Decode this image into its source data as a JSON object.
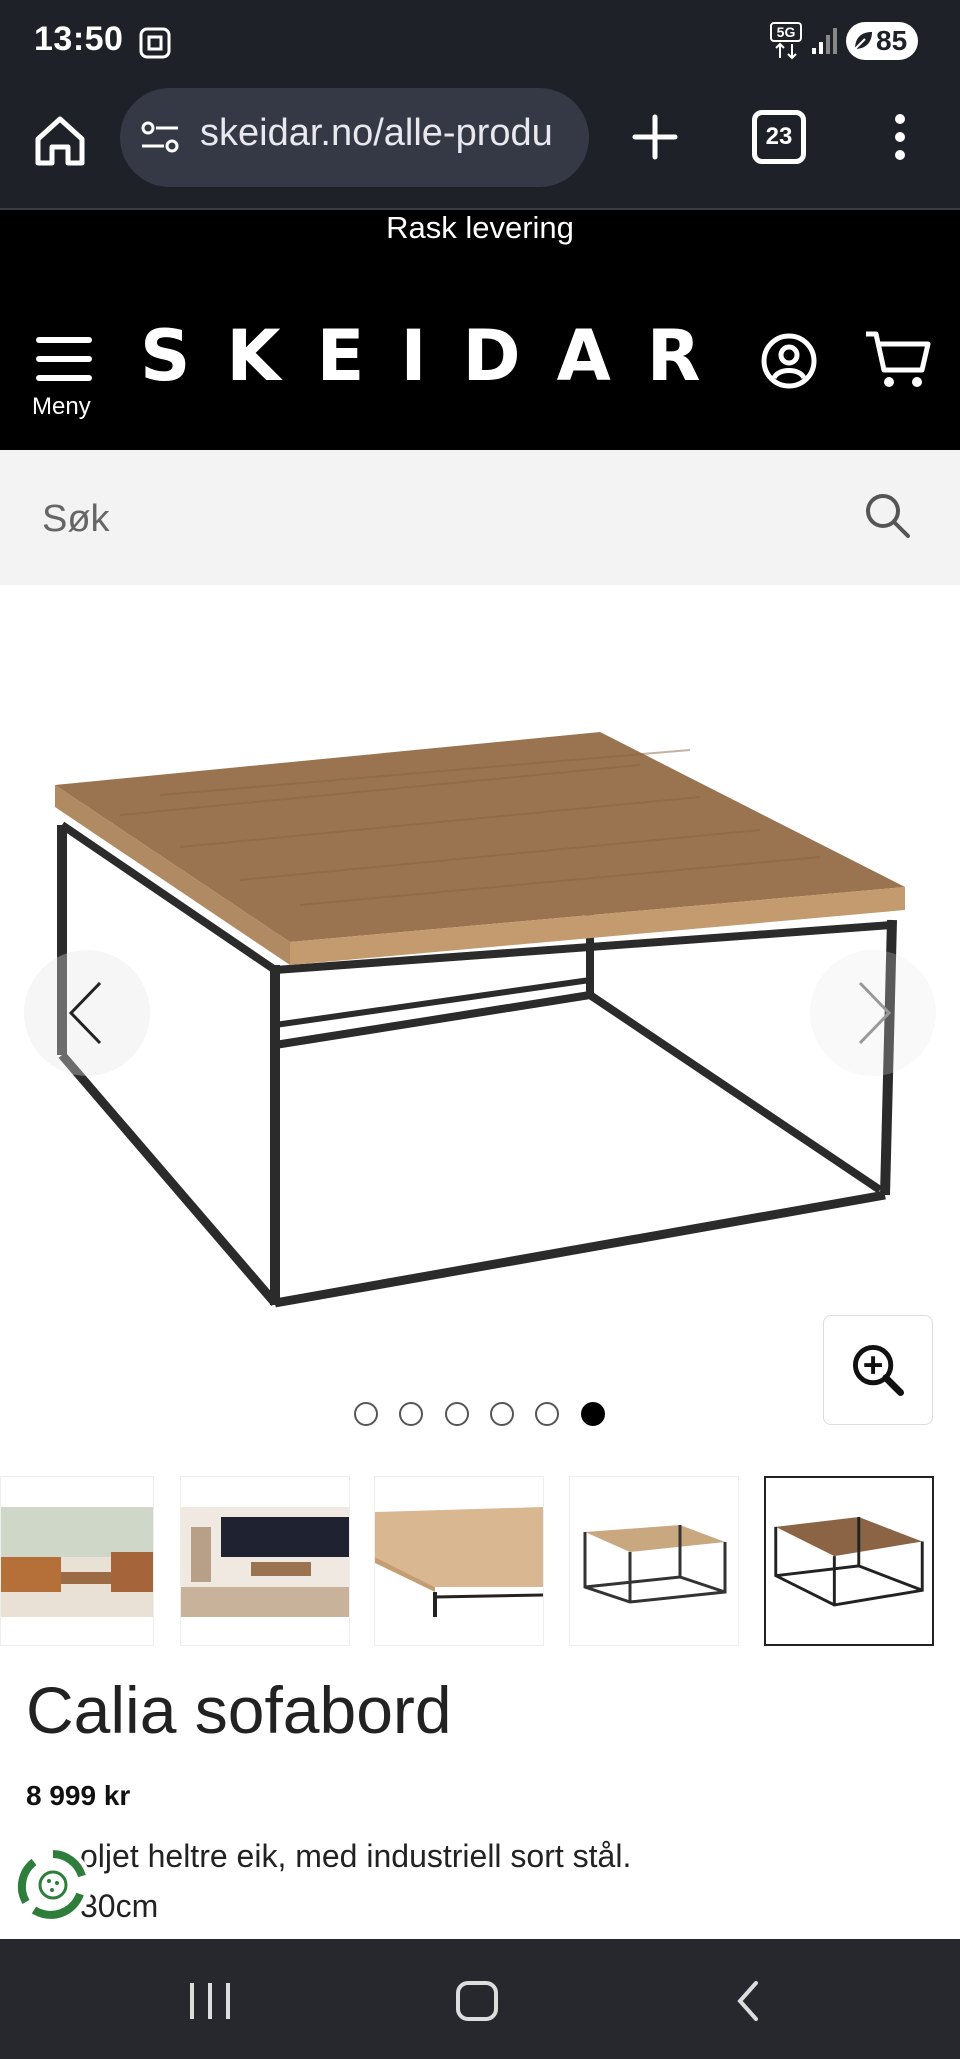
{
  "status_bar": {
    "time": "13:50",
    "battery": "85"
  },
  "browser": {
    "url": "skeidar.no/alle-produ",
    "tab_count": "23"
  },
  "header": {
    "promo": "Rask levering",
    "menu_label": "Meny",
    "logo": "SKEIDAR"
  },
  "search": {
    "placeholder": "Søk"
  },
  "gallery": {
    "image_count": 6,
    "active_index": 5
  },
  "product": {
    "title": "Calia sofabord",
    "price": "8 999 kr",
    "description_line1": "oljet heltre eik, med industriell sort stål.",
    "description_line2": "30cm"
  },
  "colors": {
    "brand_bg": "#000000",
    "wood": "#9a7350",
    "steel": "#2b2b2b",
    "chat_green": "#2f7d3b"
  }
}
